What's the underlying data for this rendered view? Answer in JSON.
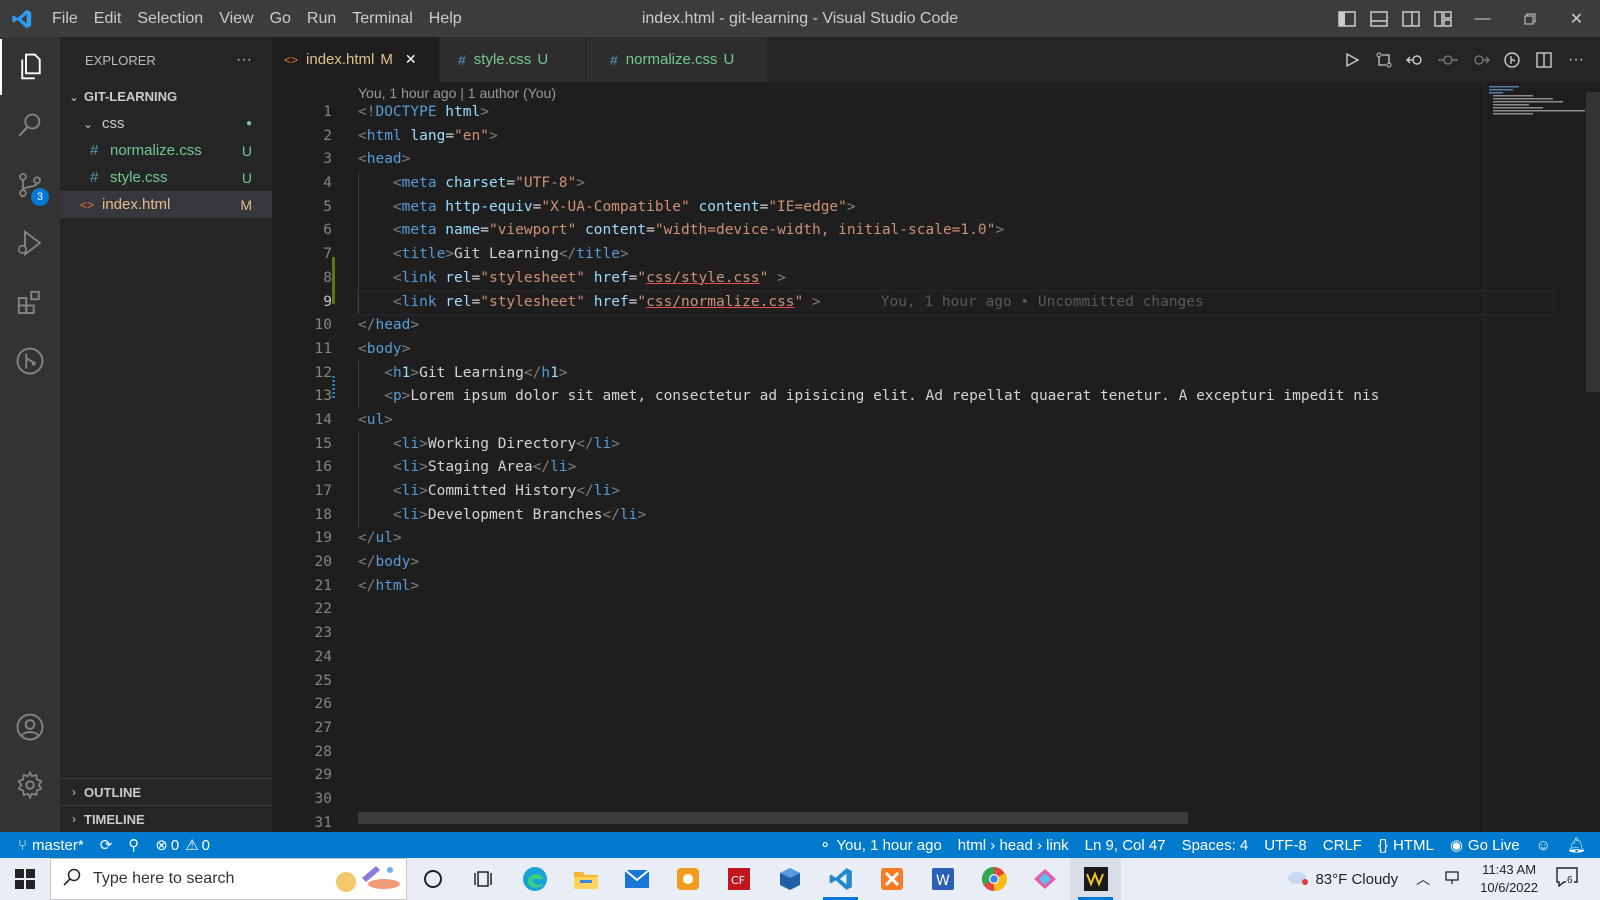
{
  "titlebar": {
    "menu": [
      "File",
      "Edit",
      "Selection",
      "View",
      "Go",
      "Run",
      "Terminal",
      "Help"
    ],
    "title": "index.html - git-learning - Visual Studio Code"
  },
  "activity": {
    "source_control_badge": "3"
  },
  "sidebar": {
    "header": "EXPLORER",
    "more": "···",
    "root": "GIT-LEARNING",
    "folder": "css",
    "files": [
      {
        "name": "normalize.css",
        "status": "U",
        "icon": "#"
      },
      {
        "name": "style.css",
        "status": "U",
        "icon": "#"
      },
      {
        "name": "index.html",
        "status": "M",
        "icon": "<>"
      }
    ],
    "outline": "OUTLINE",
    "timeline": "TIMELINE"
  },
  "tabs": [
    {
      "icon": "<>",
      "label": "index.html",
      "status": "M",
      "close": "✕"
    },
    {
      "icon": "#",
      "label": "style.css",
      "status": "U"
    },
    {
      "icon": "#",
      "label": "normalize.css",
      "status": "U"
    }
  ],
  "editor": {
    "codelens": "You, 1 hour ago | 1 author (You)",
    "blame": "You, 1 hour ago • Uncommitted changes",
    "line_numbers": [
      "1",
      "2",
      "3",
      "4",
      "5",
      "6",
      "7",
      "8",
      "9",
      "10",
      "11",
      "12",
      "13",
      "14",
      "15",
      "16",
      "17",
      "18",
      "19",
      "20",
      "21",
      "22",
      "23",
      "24",
      "25",
      "26",
      "27",
      "28",
      "29",
      "30",
      "31"
    ],
    "lines": [
      "<!DOCTYPE html>",
      "<html lang=\"en\">",
      "<head>",
      "    <meta charset=\"UTF-8\">",
      "    <meta http-equiv=\"X-UA-Compatible\" content=\"IE=edge\">",
      "    <meta name=\"viewport\" content=\"width=device-width, initial-scale=1.0\">",
      "    <title>Git Learning</title>",
      "    <link rel=\"stylesheet\" href=\"css/style.css\" >",
      "    <link rel=\"stylesheet\" href=\"css/normalize.css\" >",
      "</head>",
      "<body>",
      "   <h1>Git Learning</h1>",
      "   <p>Lorem ipsum dolor sit amet, consectetur ad ipisicing elit. Ad repellat quaerat tenetur. A excepturi impedit nis",
      "<ul>",
      "    <li>Working Directory</li>",
      "    <li>Staging Area</li>",
      "    <li>Committed History</li>",
      "    <li>Development Branches</li>",
      "</ul>",
      "</body>",
      "</html>"
    ]
  },
  "statusbar": {
    "branch": "master*",
    "problems_errors": "0",
    "problems_warnings": "0",
    "blame": "You, 1 hour ago",
    "breadcrumb": "html › head › link",
    "position": "Ln 9, Col 47",
    "spaces": "Spaces: 4",
    "encoding": "UTF-8",
    "eol": "CRLF",
    "language": "HTML",
    "golive": "Go Live"
  },
  "taskbar": {
    "search_placeholder": "Type here to search",
    "weather": "83°F  Cloudy",
    "time": "11:43 AM",
    "date": "10/6/2022",
    "notifications": "6"
  },
  "colors": {
    "accent": "#007acc",
    "modified": "#e2c08d",
    "untracked": "#73c991"
  }
}
